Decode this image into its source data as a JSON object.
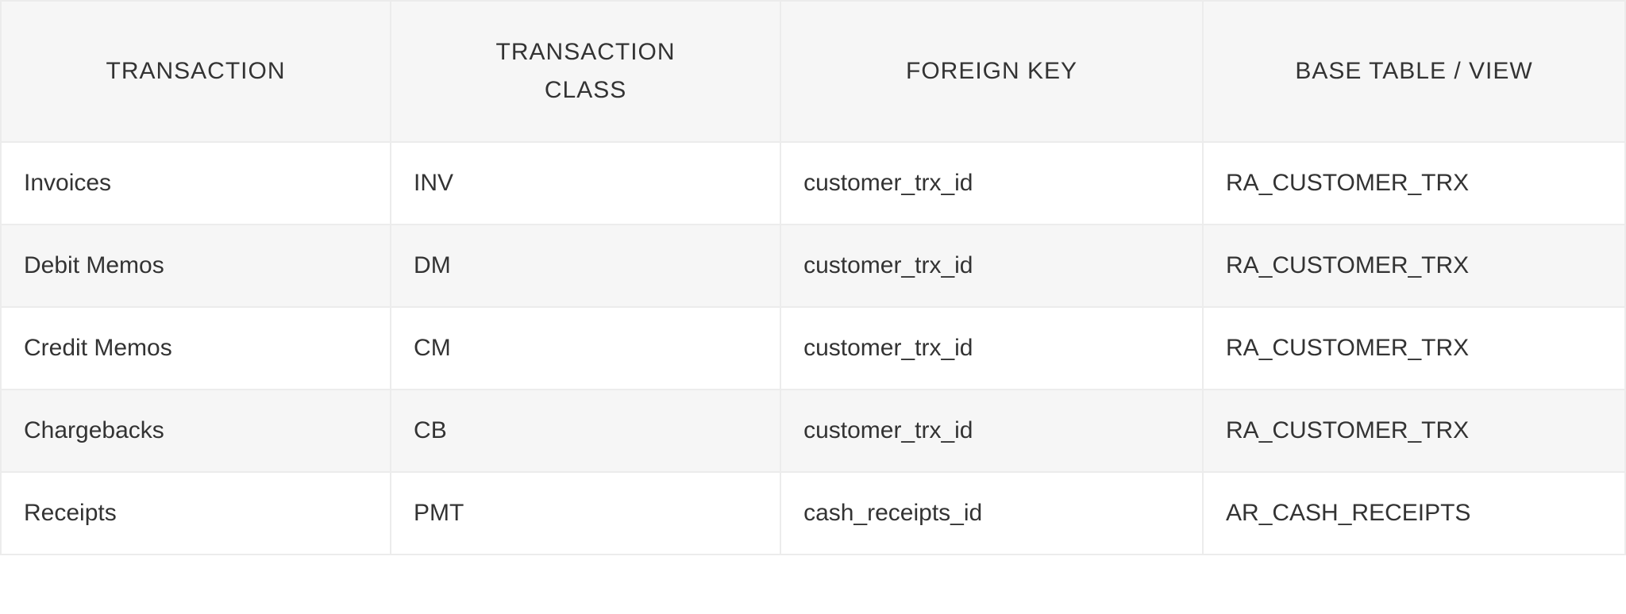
{
  "table": {
    "headers": {
      "transaction": "TRANSACTION",
      "class_line1": "TRANSACTION",
      "class_line2": "CLASS",
      "foreign_key": "FOREIGN KEY",
      "base_table": "BASE TABLE / VIEW"
    },
    "rows": [
      {
        "transaction": "Invoices",
        "class": "INV",
        "foreign_key": "customer_trx_id",
        "base_table": "RA_CUSTOMER_TRX"
      },
      {
        "transaction": "Debit Memos",
        "class": "DM",
        "foreign_key": "customer_trx_id",
        "base_table": "RA_CUSTOMER_TRX"
      },
      {
        "transaction": "Credit Memos",
        "class": "CM",
        "foreign_key": "customer_trx_id",
        "base_table": "RA_CUSTOMER_TRX"
      },
      {
        "transaction": "Chargebacks",
        "class": "CB",
        "foreign_key": "customer_trx_id",
        "base_table": "RA_CUSTOMER_TRX"
      },
      {
        "transaction": "Receipts",
        "class": "PMT",
        "foreign_key": "cash_receipts_id",
        "base_table": "AR_CASH_RECEIPTS"
      }
    ]
  }
}
